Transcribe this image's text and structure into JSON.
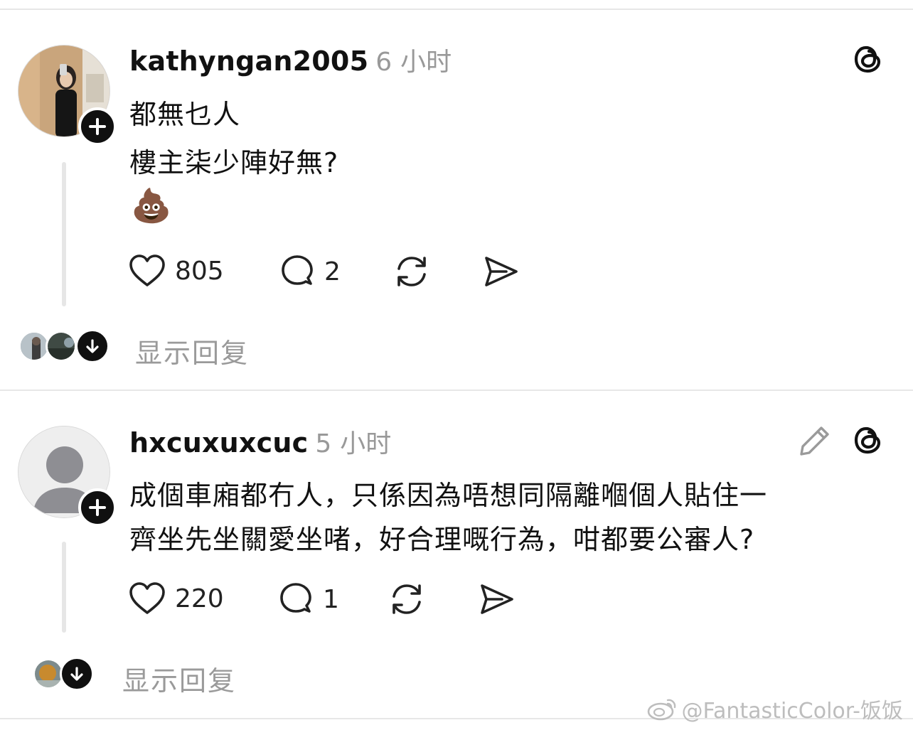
{
  "posts": [
    {
      "username": "kathyngan2005",
      "timestamp": "6 小时",
      "lines": [
        "都無乜人",
        "樓主柒少陣好無?"
      ],
      "emoji": "💩",
      "likes": "805",
      "comments": "2",
      "show_replies": "显示回复"
    },
    {
      "username": "hxcuxuxcuc",
      "timestamp": "5 小时",
      "lines": [
        "成個車廂都冇人，只係因為唔想同隔離嗰個人貼住一",
        "齊坐先坐關愛坐啫，好合理嘅行為，咁都要公審人?"
      ],
      "likes": "220",
      "comments": "1",
      "show_replies": "显示回复"
    }
  ],
  "watermark": "@FantasticColor-饭饭",
  "icons": [
    "threads-icon",
    "plus-icon",
    "heart-icon",
    "comment-icon",
    "repost-icon",
    "share-icon",
    "arrow-down-icon",
    "pencil-icon",
    "weibo-icon"
  ]
}
